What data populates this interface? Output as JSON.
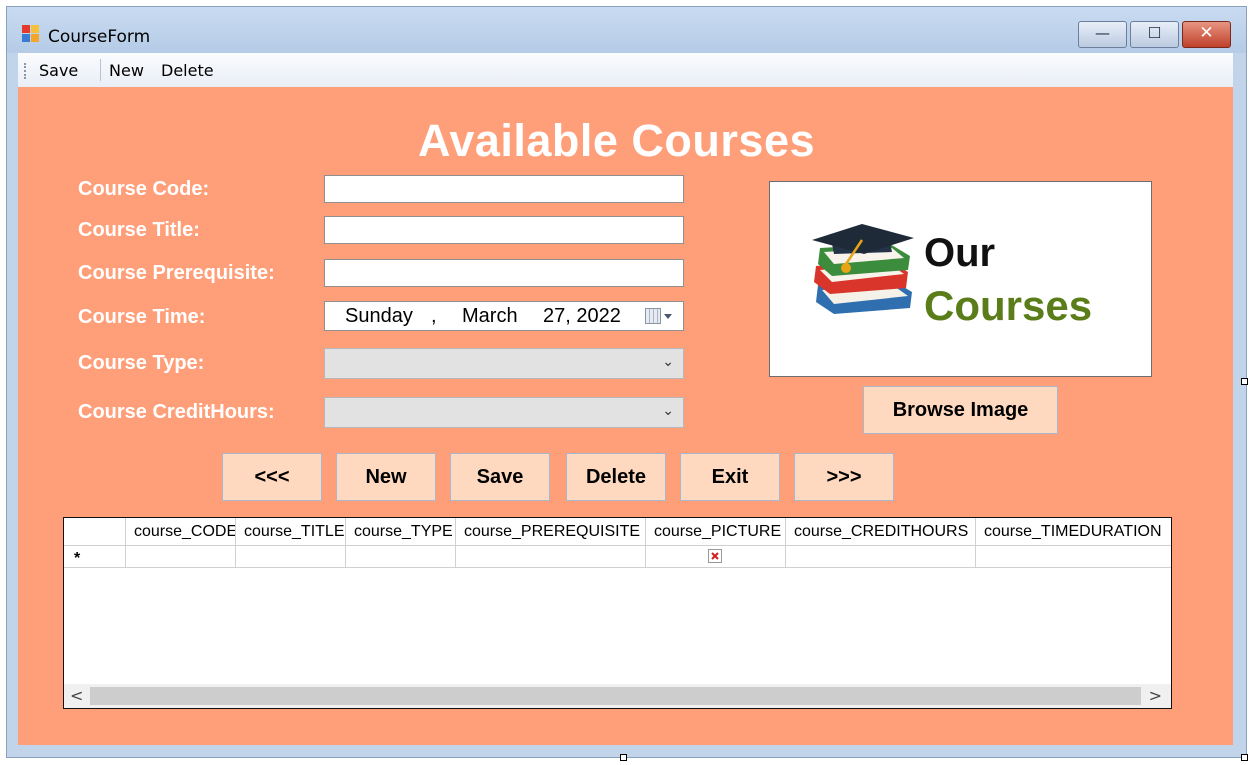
{
  "window": {
    "title": "CourseForm",
    "minimize_glyph": "—",
    "maximize_glyph": "☐",
    "close_glyph": "✕"
  },
  "menu": {
    "items": [
      "Save",
      "New",
      "Delete"
    ]
  },
  "form": {
    "heading": "Available Courses",
    "labels": {
      "code": "Course Code:",
      "title": "Course Title:",
      "prerequisite": "Course Prerequisite:",
      "time": "Course Time:",
      "type": "Course Type:",
      "credit_hours": "Course CreditHours:"
    },
    "values": {
      "code": "",
      "title": "",
      "prerequisite": "",
      "type": "",
      "credit_hours": ""
    },
    "date": {
      "weekday": "Sunday",
      "comma": ",",
      "month": "March",
      "day_year": "27, 2022"
    }
  },
  "picture": {
    "logo_line1": "Our",
    "logo_line2": "Courses",
    "colors": {
      "line1": "#111111",
      "line2": "#5a7d1a"
    }
  },
  "buttons": {
    "browse": "Browse Image",
    "prev": "<<<",
    "new": "New",
    "save": "Save",
    "delete": "Delete",
    "exit": "Exit",
    "next": ">>>"
  },
  "grid": {
    "columns": [
      "course_CODE",
      "course_TITLE",
      "course_TYPE",
      "course_PREREQUISITE",
      "course_PICTURE",
      "course_CREDITHOURS",
      "course_TIMEDURATION"
    ],
    "new_row_marker": "*",
    "scroll_left": "<",
    "scroll_right": ">"
  },
  "colors": {
    "form_background": "#ff9f7a",
    "button_background": "#ffd9bf"
  }
}
